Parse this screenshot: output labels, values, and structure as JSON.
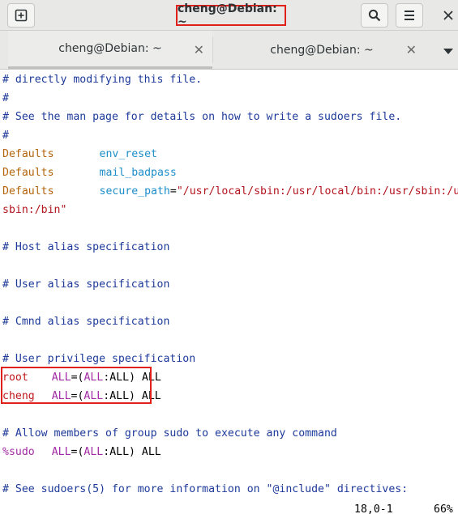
{
  "window": {
    "title": "cheng@Debian: ~",
    "accent_color": "#e0201b"
  },
  "header": {
    "new_tab_icon": "new-tab-icon",
    "search_icon": "search-icon",
    "menu_icon": "hamburger-menu-icon",
    "close_label": "✕"
  },
  "tabs": [
    {
      "label": "cheng@Debian: ~",
      "close": "✕",
      "active": true
    },
    {
      "label": "cheng@Debian: ~",
      "close": "✕",
      "active": false
    }
  ],
  "terminal": {
    "lines": {
      "l1": "# directly modifying this file.",
      "l2": "#",
      "l3": "# See the man page for details on how to write a sudoers file.",
      "l4": "#",
      "l5_kw": "Defaults",
      "l5_val": "env_reset",
      "l6_kw": "Defaults",
      "l6_val": "mail_badpass",
      "l7_kw": "Defaults",
      "l7_opt": "secure_path",
      "l7_eq": "=",
      "l7_str": "\"/usr/local/sbin:/usr/local/bin:/usr/sbin:/usr/bin:/s",
      "l8_str": "sbin:/bin\"",
      "l9": "# Host alias specification",
      "l10": "# User alias specification",
      "l11": "# Cmnd alias specification",
      "l12": "# User privilege specification",
      "l13_user": "root",
      "l14_user": "cheng",
      "l16": "# Allow members of group sudo to execute any command",
      "l17_group": "%sudo",
      "l18": "# See sudoers(5) for more information on \"@include\" directives:"
    },
    "rule_tokens": {
      "all1": "ALL",
      "eq": "=(",
      "all2": "ALL",
      "colon": ":",
      "all3": "ALL",
      "close": ") ",
      "all4": "ALL"
    },
    "status": {
      "position": "18,0-1",
      "percent": "66%"
    }
  }
}
